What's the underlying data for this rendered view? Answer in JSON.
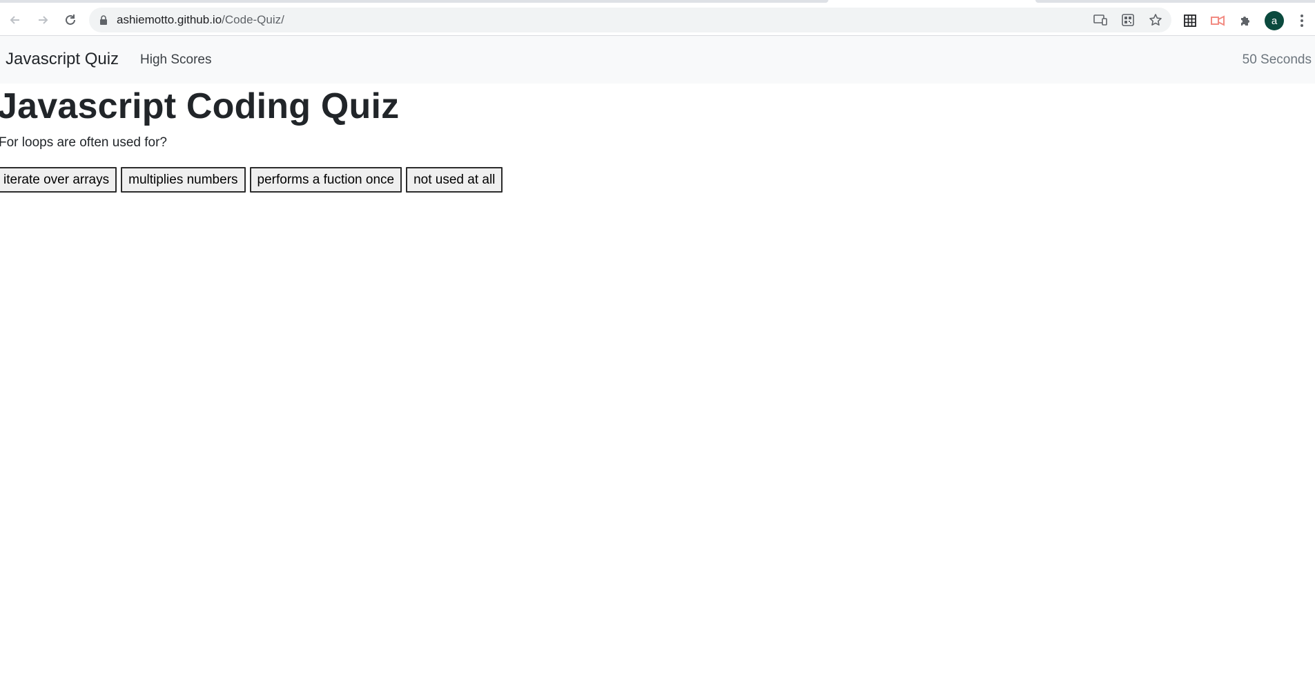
{
  "browser": {
    "url_host": "ashiemotto.github.io",
    "url_path": "/Code-Quiz/",
    "icons": {
      "back": "back-arrow-icon",
      "forward": "forward-arrow-icon",
      "reload": "reload-icon",
      "lock": "lock-icon",
      "cast": "cast-icon",
      "qr": "qr-code-icon",
      "bookmark": "star-icon",
      "ext1": "grid-extension-icon",
      "ext2": "screencast-extension-icon",
      "extensions": "puzzle-icon",
      "menu": "more-vert-icon"
    },
    "avatar_letter": "a",
    "avatar_color": "#0b4a3e"
  },
  "navbar": {
    "brand": "Javascript Quiz",
    "link": "High Scores",
    "timer": "50 Seconds"
  },
  "main": {
    "title": "Javascript Coding Quiz",
    "question": "For loops are often used for?",
    "choices": [
      "iterate over arrays",
      "multiplies numbers",
      "performs a fuction once",
      "not used at all"
    ]
  }
}
